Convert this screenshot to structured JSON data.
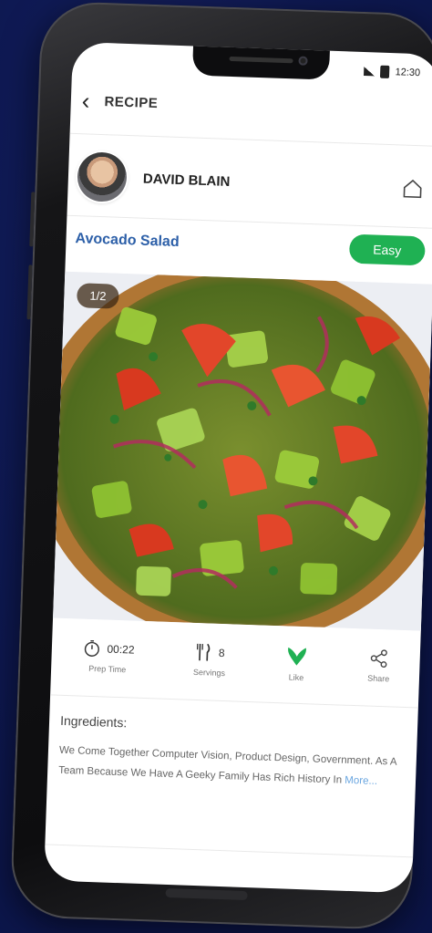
{
  "status_bar": {
    "time": "12:30"
  },
  "header": {
    "back_icon": "chevron-left-icon",
    "title": "RECIPE"
  },
  "author": {
    "name": "DAVID BLAIN",
    "home_icon": "home-icon"
  },
  "recipe": {
    "name": "Avocado Salad",
    "difficulty": "Easy",
    "image_counter": "1/2"
  },
  "stats": [
    {
      "icon": "timer-icon",
      "value": "00:22",
      "label": "Prep Time"
    },
    {
      "icon": "servings-icon",
      "value": "8",
      "label": "Servings"
    },
    {
      "icon": "like-icon",
      "value": "",
      "label": "Like"
    },
    {
      "icon": "share-icon",
      "value": "",
      "label": "Share"
    }
  ],
  "ingredients": {
    "title": "Ingredients:",
    "text": "We Come Together Computer Vision, Product Design, Government. As A Team Because We Have A Geeky Family Has Rich History In ",
    "more": "More..."
  },
  "colors": {
    "accent_green": "#1fb153",
    "recipe_blue": "#2c5fa8",
    "background": "#0f1a55"
  }
}
